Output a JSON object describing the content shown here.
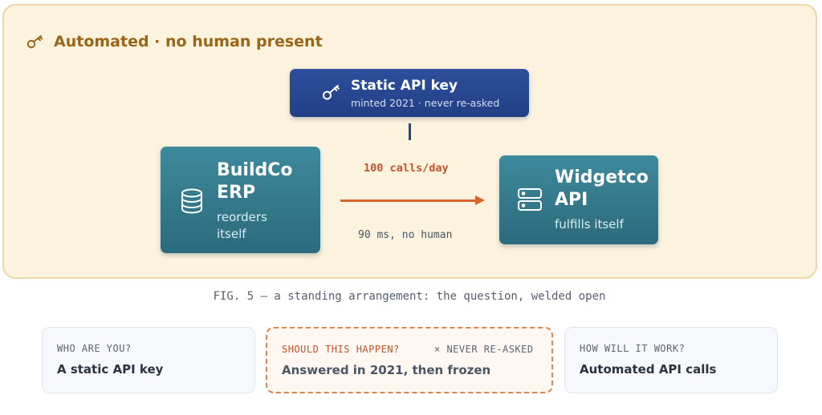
{
  "panel": {
    "title": "Automated · no human present",
    "icon": "key-icon",
    "accent_color": "#9a6516"
  },
  "credential": {
    "title": "Static API key",
    "subtitle": "minted 2021 · never re-asked",
    "icon": "key-icon",
    "color": "#28448b"
  },
  "source_node": {
    "title_line1": "BuildCo",
    "title_line2": "ERP",
    "desc_line1": "reorders",
    "desc_line2": "itself",
    "icon": "database-icon",
    "color": "#2c6a7c"
  },
  "target_node": {
    "title_line1": "Widgetco",
    "title_line2": "API",
    "desc": "fulfills itself",
    "icon": "server-icon",
    "color": "#2c6a7c"
  },
  "flow": {
    "rate": "100 calls/day",
    "latency": "90 ms, no human",
    "color": "#d9632d"
  },
  "caption": "FIG. 5 — a standing arrangement: the question, welded open",
  "cards": {
    "who": {
      "label": "WHO ARE YOU?",
      "value": "A static API key"
    },
    "should": {
      "label": "SHOULD THIS HAPPEN?",
      "note": "× NEVER RE-ASKED",
      "value": "Answered in 2021, then frozen",
      "accent_color": "#de8547"
    },
    "how": {
      "label": "HOW WILL IT WORK?",
      "value": "Automated API calls"
    }
  }
}
